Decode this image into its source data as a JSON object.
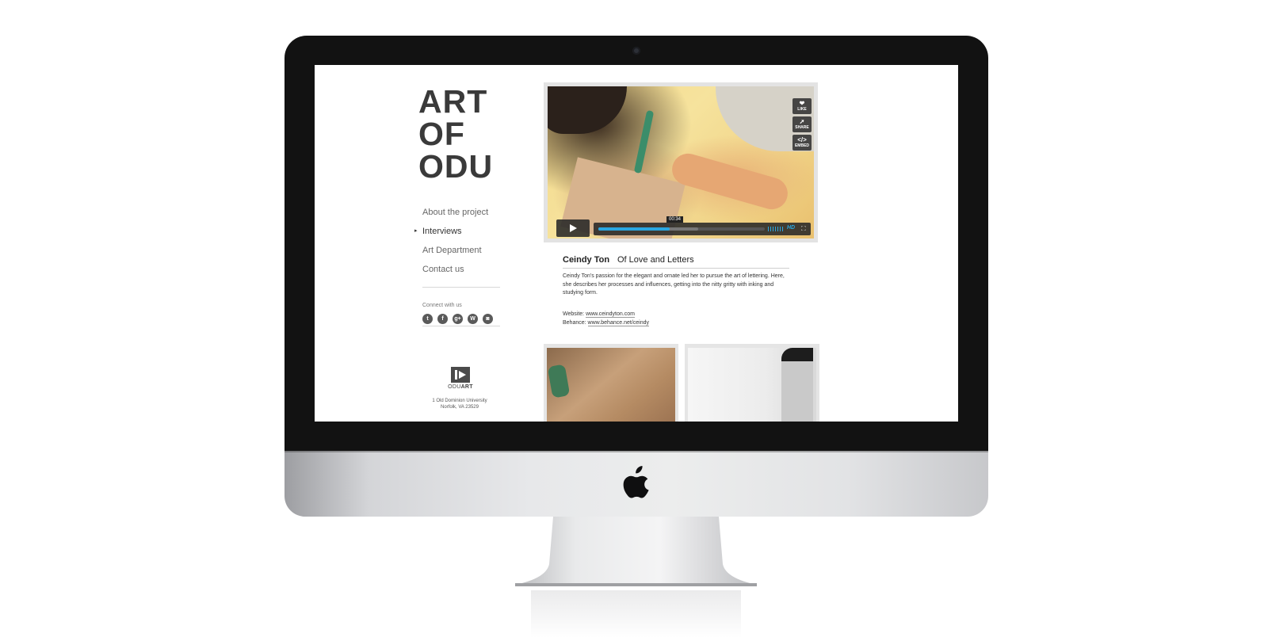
{
  "site": {
    "logo_lines": [
      "ART",
      "OF",
      "ODU"
    ]
  },
  "nav": {
    "items": [
      {
        "label": "About the project",
        "active": false
      },
      {
        "label": "Interviews",
        "active": true
      },
      {
        "label": "Art Department",
        "active": false
      },
      {
        "label": "Contact us",
        "active": false
      }
    ],
    "active_marker": "▸"
  },
  "connect": {
    "label": "Connect with us",
    "icons": [
      "twitter-icon",
      "facebook-icon",
      "google-plus-icon",
      "wordpress-icon",
      "instagram-icon"
    ],
    "glyphs": [
      "t",
      "f",
      "g+",
      "W",
      "◙"
    ]
  },
  "footer": {
    "brand_prefix": "ODU",
    "brand_suffix": "ART",
    "address_line1": "1 Old Dominion University",
    "address_line2": "Norfolk, VA 23529"
  },
  "video": {
    "actions": [
      {
        "label": "LIKE",
        "icon": "heart-icon",
        "glyph": "❤"
      },
      {
        "label": "SHARE",
        "icon": "share-icon",
        "glyph": "➚"
      },
      {
        "label": "EMBED",
        "icon": "code-icon",
        "glyph": "</>"
      }
    ],
    "current_time": "00:34",
    "progress": 0.43,
    "quality": "HD",
    "accent_color": "#2aa6e0"
  },
  "interview": {
    "name": "Ceindy Ton",
    "title": "Of Love and Letters",
    "body": "Ceindy Ton's passion for the elegant and ornate led her to pursue the art of lettering. Here, she describes her processes and influences, getting into the nitty gritty with inking and studying form.",
    "website_label": "Website:",
    "website_url": "www.ceindyton.com",
    "behance_label": "Behance:",
    "behance_url": "www.behance.net/ceindy"
  }
}
